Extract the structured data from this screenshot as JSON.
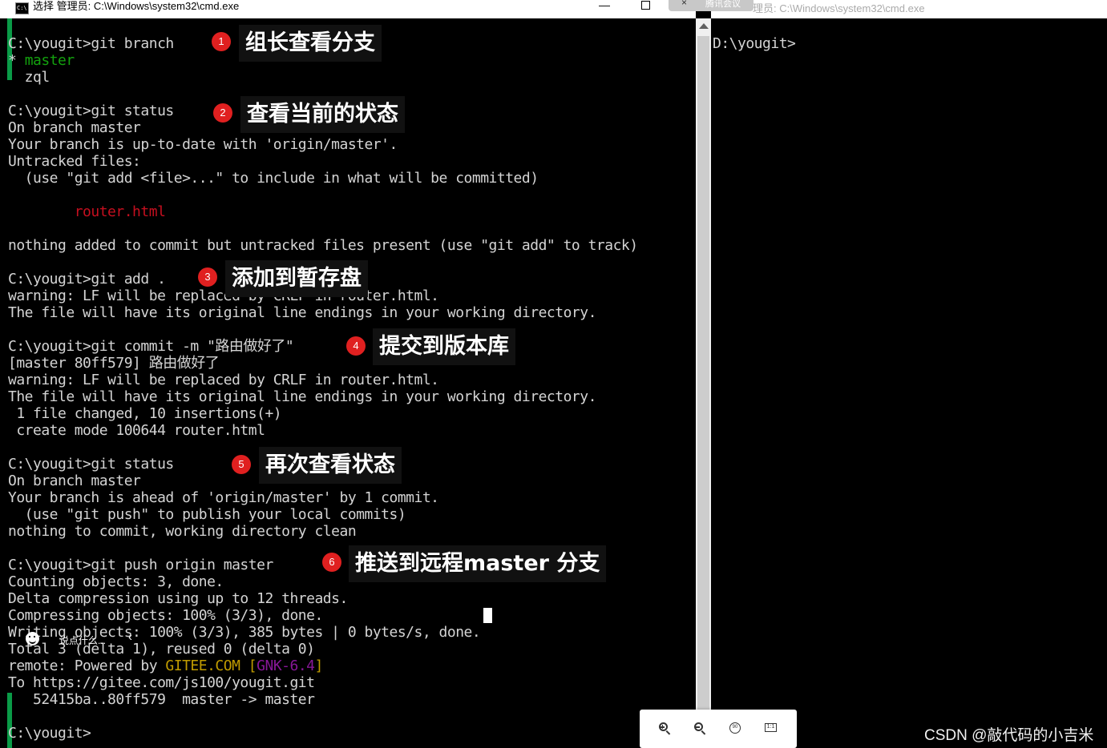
{
  "left_window": {
    "title": "选择 管理员: C:\\Windows\\system32\\cmd.exe",
    "minimize_glyph": "—",
    "lines": [
      [
        {
          "t": "C:\\yougit>git branch"
        }
      ],
      [
        {
          "t": "* ",
          "c": "d"
        },
        {
          "t": "master",
          "c": "green"
        }
      ],
      [
        {
          "t": "  zql"
        }
      ],
      [
        {
          "t": ""
        }
      ],
      [
        {
          "t": "C:\\yougit>git status"
        }
      ],
      [
        {
          "t": "On branch master"
        }
      ],
      [
        {
          "t": "Your branch is up-to-date with 'origin/master'."
        }
      ],
      [
        {
          "t": "Untracked files:"
        }
      ],
      [
        {
          "t": "  (use \"git add <file>...\" to include in what will be committed)"
        }
      ],
      [
        {
          "t": ""
        }
      ],
      [
        {
          "t": "        "
        },
        {
          "t": "router.html",
          "c": "red"
        }
      ],
      [
        {
          "t": ""
        }
      ],
      [
        {
          "t": "nothing added to commit but untracked files present (use \"git add\" to track)"
        }
      ],
      [
        {
          "t": ""
        }
      ],
      [
        {
          "t": "C:\\yougit>git add ."
        }
      ],
      [
        {
          "t": "warning: LF will be replaced by CRLF in router.html."
        }
      ],
      [
        {
          "t": "The file will have its original line endings in your working directory."
        }
      ],
      [
        {
          "t": ""
        }
      ],
      [
        {
          "t": "C:\\yougit>git commit -m \"路由做好了\""
        }
      ],
      [
        {
          "t": "[master 80ff579] 路由做好了"
        }
      ],
      [
        {
          "t": "warning: LF will be replaced by CRLF in router.html."
        }
      ],
      [
        {
          "t": "The file will have its original line endings in your working directory."
        }
      ],
      [
        {
          "t": " 1 file changed, 10 insertions(+)"
        }
      ],
      [
        {
          "t": " create mode 100644 router.html"
        }
      ],
      [
        {
          "t": ""
        }
      ],
      [
        {
          "t": "C:\\yougit>git status"
        }
      ],
      [
        {
          "t": "On branch master"
        }
      ],
      [
        {
          "t": "Your branch is ahead of 'origin/master' by 1 commit."
        }
      ],
      [
        {
          "t": "  (use \"git push\" to publish your local commits)"
        }
      ],
      [
        {
          "t": "nothing to commit, working directory clean"
        }
      ],
      [
        {
          "t": ""
        }
      ],
      [
        {
          "t": "C:\\yougit>git push origin master"
        }
      ],
      [
        {
          "t": "Counting objects: 3, done."
        }
      ],
      [
        {
          "t": "Delta compression using up to 12 threads."
        }
      ],
      [
        {
          "t": "Compressing objects: 100% (3/3), done."
        }
      ],
      [
        {
          "t": "Writing objects: 100% (3/3), 385 bytes | 0 bytes/s, done."
        }
      ],
      [
        {
          "t": "Total 3 (delta 1), reused 0 (delta 0)"
        }
      ],
      [
        {
          "t": "remote: Powered by "
        },
        {
          "t": "GITEE.COM",
          "c": "yellow"
        },
        {
          "t": " "
        },
        {
          "t": "[",
          "c": "yellow"
        },
        {
          "t": "GNK-6.4",
          "c": "mag"
        },
        {
          "t": "]",
          "c": "yellow"
        }
      ],
      [
        {
          "t": "To https://gitee.com/js100/yougit.git"
        }
      ],
      [
        {
          "t": "   52415ba..80ff579  master -> master"
        }
      ],
      [
        {
          "t": ""
        }
      ],
      [
        {
          "t": "C:\\yougit>"
        }
      ]
    ]
  },
  "right_window": {
    "title": "理员: C:\\Windows\\system32\\cmd.exe",
    "tab_label": "腾讯会议",
    "tab_close": "×",
    "prompt": "D:\\yougit>"
  },
  "annotations": [
    {
      "num": "1",
      "label": "组长查看分支"
    },
    {
      "num": "2",
      "label": "查看当前的状态"
    },
    {
      "num": "3",
      "label": "添加到暂存盘"
    },
    {
      "num": "4",
      "label": "提交到版本库"
    },
    {
      "num": "5",
      "label": "再次查看状态"
    },
    {
      "num": "6",
      "label": "推送到远程master 分支"
    }
  ],
  "comment_widget": {
    "text": "说点什么...",
    "chevron": "‹"
  },
  "zoom_toolbar": {
    "rotate_label": "90",
    "fit_label": "1:1"
  },
  "watermark": "CSDN @敲代码的小吉米",
  "colors": {
    "green": "#13a10e",
    "red": "#c50f1f",
    "yellow": "#c19c00",
    "magenta": "#881798",
    "badge": "#e02020",
    "accent_bar": "#0a9b47"
  }
}
